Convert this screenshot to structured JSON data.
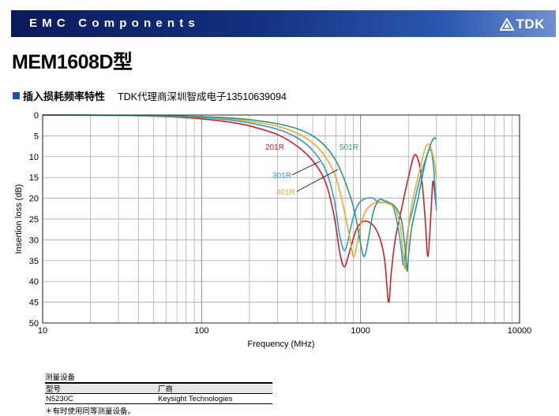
{
  "header": {
    "banner_title": "EMC Components",
    "brand": "TDK"
  },
  "product": {
    "title": "MEM1608D型"
  },
  "section": {
    "title": "插入损耗频率特性",
    "note": "TDK代理商深圳智成电子13510639094"
  },
  "colors": {
    "banner": "#13327f",
    "section_marker": "#1f4fa8",
    "s201R": "#d0202a",
    "s301R": "#2a9fd0",
    "s401R": "#f0a830",
    "s501R": "#2a9a80"
  },
  "chart_data": {
    "type": "line",
    "x_scale": "log",
    "xlabel": "Frequency (MHz)",
    "ylabel": "Insertion loss (dB)",
    "xlim": [
      10,
      10000
    ],
    "ylim": [
      0,
      50
    ],
    "y_inverted": true,
    "x_ticks": [
      "10",
      "100",
      "1000",
      "10000"
    ],
    "y_ticks": [
      "0",
      "5",
      "10",
      "15",
      "20",
      "25",
      "30",
      "35",
      "40",
      "45",
      "50"
    ],
    "grid": true,
    "series": [
      {
        "name": "201R",
        "color": "#d0202a",
        "x": [
          10,
          30,
          60,
          100,
          150,
          200,
          300,
          400,
          500,
          600,
          680,
          740,
          790,
          850,
          930,
          1000,
          1080,
          1200,
          1320,
          1420,
          1500,
          1560,
          1650,
          1800,
          2000,
          2200,
          2400,
          2550,
          2650,
          2760,
          2850,
          2950,
          3000
        ],
        "y": [
          0,
          0.1,
          0.4,
          0.9,
          1.7,
          2.6,
          4.7,
          7.5,
          11,
          16,
          24,
          33,
          36.5,
          33,
          28,
          26,
          25.5,
          26.5,
          29.5,
          35,
          45,
          38,
          30,
          23,
          15,
          9.5,
          14,
          25,
          34,
          25,
          16,
          20,
          22
        ]
      },
      {
        "name": "301R",
        "color": "#2a9fd0",
        "x": [
          10,
          30,
          60,
          100,
          150,
          200,
          300,
          400,
          500,
          600,
          680,
          740,
          800,
          880,
          950,
          1020,
          1100,
          1200,
          1300,
          1450,
          1600,
          1720,
          1800,
          1850,
          1900,
          2000,
          2150,
          2300,
          2450,
          2600,
          2700,
          2800,
          2900,
          3000
        ],
        "y": [
          0,
          0.1,
          0.3,
          0.6,
          1.2,
          1.9,
          3.4,
          5.5,
          8.5,
          13,
          20,
          29,
          32.5,
          26,
          22,
          20.5,
          20,
          20,
          21,
          21,
          22,
          27,
          32,
          36,
          34,
          27,
          22,
          17,
          13,
          10,
          8.5,
          9,
          14,
          23
        ]
      },
      {
        "name": "401R",
        "color": "#f0a830",
        "x": [
          10,
          30,
          60,
          100,
          150,
          200,
          300,
          400,
          500,
          600,
          700,
          780,
          850,
          900,
          940,
          1000,
          1080,
          1150,
          1250,
          1350,
          1500,
          1650,
          1780,
          1860,
          1900,
          1950,
          2050,
          2200,
          2400,
          2550,
          2700,
          2800,
          2900,
          3000
        ],
        "y": [
          0,
          0.1,
          0.2,
          0.5,
          0.9,
          1.5,
          2.7,
          4.4,
          6.7,
          10,
          15,
          22,
          29,
          34,
          32,
          26.5,
          23,
          21.8,
          21,
          21,
          21.3,
          22.5,
          27,
          34,
          37,
          32,
          24,
          18,
          12,
          8,
          7,
          8.5,
          11,
          15
        ]
      },
      {
        "name": "501R",
        "color": "#2a9a80",
        "x": [
          10,
          30,
          60,
          100,
          150,
          200,
          300,
          400,
          500,
          600,
          700,
          800,
          900,
          960,
          1000,
          1050,
          1100,
          1200,
          1300,
          1400,
          1500,
          1650,
          1800,
          1900,
          1960,
          2000,
          2100,
          2300,
          2500,
          2650,
          2800,
          2900,
          2950,
          3000
        ],
        "y": [
          0,
          0.05,
          0.15,
          0.4,
          0.7,
          1.1,
          2.1,
          3.3,
          5,
          7.5,
          11,
          16,
          22,
          27,
          31,
          34,
          31.5,
          23.5,
          20.5,
          20.5,
          21,
          22,
          25,
          31.5,
          37.5,
          34,
          27,
          20,
          13,
          9,
          6.5,
          5.5,
          5.6,
          5.8
        ]
      }
    ]
  },
  "equipment": {
    "title": "测量设备",
    "headers": [
      "型号",
      "厂商"
    ],
    "rows": [
      [
        "N5230C",
        "Keysight Technologies"
      ]
    ],
    "note": "＊有时使用同等测量设备。"
  }
}
